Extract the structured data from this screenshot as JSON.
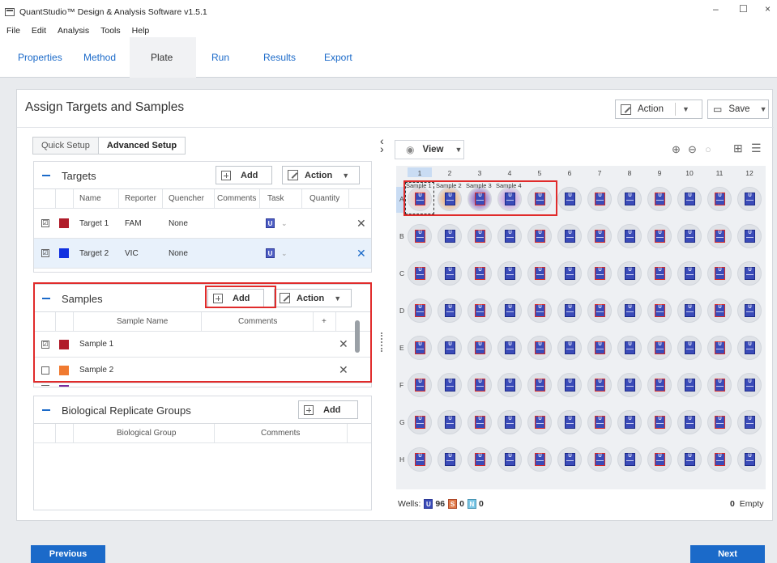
{
  "window": {
    "title": "QuantStudio™ Design & Analysis Software v1.5.1",
    "minimize": "–",
    "maximize": "☐",
    "close": "×"
  },
  "menu": [
    "File",
    "Edit",
    "Analysis",
    "Tools",
    "Help"
  ],
  "tabs": [
    {
      "label": "Properties",
      "active": false
    },
    {
      "label": "Method",
      "active": false
    },
    {
      "label": "Plate",
      "active": true
    },
    {
      "label": "Run",
      "active": false
    },
    {
      "label": "Results",
      "active": false
    },
    {
      "label": "Export",
      "active": false
    }
  ],
  "page": {
    "title": "Assign Targets and Samples",
    "action_label": "Action",
    "save_label": "Save"
  },
  "setup_tabs": [
    {
      "label": "Quick Setup",
      "active": false
    },
    {
      "label": "Advanced Setup",
      "active": true
    }
  ],
  "targets": {
    "title": "Targets",
    "add_label": "Add",
    "action_label": "Action",
    "columns": [
      "Name",
      "Reporter",
      "Quencher",
      "Comments",
      "Task",
      "Quantity"
    ],
    "rows": [
      {
        "checked": "☑",
        "color": "#b01c2a",
        "name": "Target 1",
        "reporter": "FAM",
        "quencher": "None",
        "task": "U"
      },
      {
        "checked": "☑",
        "color": "#1030e0",
        "name": "Target 2",
        "reporter": "VIC",
        "quencher": "None",
        "task": "U"
      }
    ]
  },
  "samples": {
    "title": "Samples",
    "add_label": "Add",
    "action_label": "Action",
    "columns": [
      "Sample Name",
      "Comments",
      "+"
    ],
    "rows": [
      {
        "checked": "☑",
        "color": "#b01c2a",
        "name": "Sample 1"
      },
      {
        "checked": "",
        "color": "#f07a30",
        "name": "Sample 2"
      }
    ]
  },
  "bio_groups": {
    "title": "Biological Replicate Groups",
    "add_label": "Add",
    "columns": [
      "Biological Group",
      "Comments"
    ]
  },
  "plate": {
    "view_label": "View",
    "columns": [
      "1",
      "2",
      "3",
      "4",
      "5",
      "6",
      "7",
      "8",
      "9",
      "10",
      "11",
      "12"
    ],
    "rows": [
      "A",
      "B",
      "C",
      "D",
      "E",
      "F",
      "G",
      "H"
    ],
    "sample_labels": [
      "Sample 1",
      "Sample 2",
      "Sample 3",
      "Sample 4"
    ],
    "sample_colors": [
      "#f4c7c0",
      "#f3b27a",
      "#8e64c4",
      "#c99be0"
    ],
    "well_task": "U",
    "footer_wells_label": "Wells:",
    "footer_u_count": "96",
    "footer_s_count": "0",
    "footer_n_count": "0",
    "empty_count": "0",
    "empty_label": "Empty"
  },
  "nav": {
    "previous": "Previous",
    "next": "Next"
  },
  "colors": {
    "accent": "#1b6ac9",
    "highlight": "#e02b2b",
    "unknown_task": "#3a4bb8"
  }
}
